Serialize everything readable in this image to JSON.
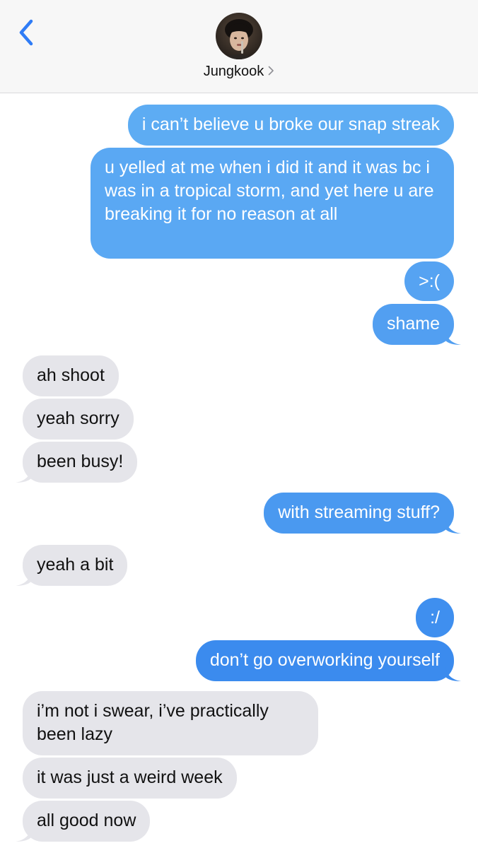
{
  "contact": {
    "name": "Jungkook"
  },
  "colors": {
    "sent_top": "#5eaaf2",
    "sent_bottom": "#3b87ee",
    "received": "#e5e5ea",
    "accent": "#2f7cf6"
  },
  "messages": [
    {
      "from": "me",
      "text": "i can’t believe u broke our snap streak"
    },
    {
      "from": "me",
      "text": "u yelled at me when i did it and it was bc i was in a tropical storm, and yet here u are breaking it for no reason at all"
    },
    {
      "from": "me",
      "text": ">:("
    },
    {
      "from": "me",
      "text": "shame"
    },
    {
      "from": "them",
      "text": "ah shoot"
    },
    {
      "from": "them",
      "text": "yeah sorry"
    },
    {
      "from": "them",
      "text": "been busy!"
    },
    {
      "from": "me",
      "text": "with streaming stuff?"
    },
    {
      "from": "them",
      "text": "yeah a bit"
    },
    {
      "from": "me",
      "text": ":/"
    },
    {
      "from": "me",
      "text": "don’t go overworking yourself"
    },
    {
      "from": "them",
      "text": "i’m not i swear, i’ve practically been lazy"
    },
    {
      "from": "them",
      "text": "it was just a weird week"
    },
    {
      "from": "them",
      "text": "all good now"
    }
  ]
}
